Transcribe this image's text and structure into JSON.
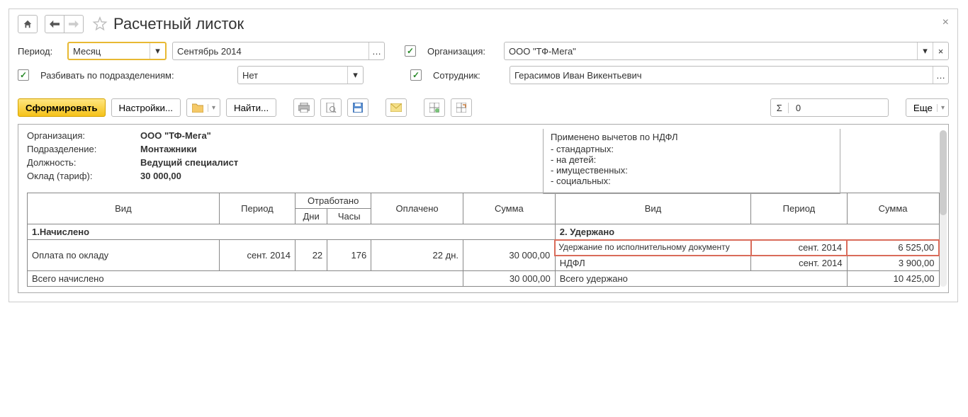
{
  "title": "Расчетный листок",
  "filters": {
    "period_label": "Период:",
    "period_mode": "Месяц",
    "period_value": "Сентябрь 2014",
    "org_label": "Организация:",
    "org_value": "ООО \"ТФ-Мега\"",
    "split_label": "Разбивать по подразделениям:",
    "split_value": "Нет",
    "emp_label": "Сотрудник:",
    "emp_value": "Герасимов Иван Викентьевич"
  },
  "toolbar": {
    "generate": "Сформировать",
    "settings": "Настройки...",
    "find": "Найти...",
    "sigma_value": "0",
    "more": "Еще"
  },
  "report": {
    "org_label": "Организация:",
    "org_value": "ООО \"ТФ-Мега\"",
    "dept_label": "Подразделение:",
    "dept_value": "Монтажники",
    "pos_label": "Должность:",
    "pos_value": "Ведущий специалист",
    "salary_label": "Оклад (тариф):",
    "salary_value": "30 000,00",
    "ded_header": "Применено вычетов по НДФЛ",
    "ded_std": "- стандартных:",
    "ded_kids": "- на детей:",
    "ded_prop": "- имущественных:",
    "ded_soc": "- социальных:"
  },
  "grid": {
    "h_type": "Вид",
    "h_period": "Период",
    "h_worked": "Отработано",
    "h_paid": "Оплачено",
    "h_sum": "Сумма",
    "h_days": "Дни",
    "h_hours": "Часы",
    "sec1": "1.Начислено",
    "sec2": "2. Удержано",
    "r1_name": "Оплата по окладу",
    "r1_period": "сент. 2014",
    "r1_days": "22",
    "r1_hours": "176",
    "r1_paid": "22 дн.",
    "r1_sum": "30 000,00",
    "r2_name": "Удержание по исполнительному документу",
    "r2_period": "сент. 2014",
    "r2_sum": "6 525,00",
    "r3_name": "НДФЛ",
    "r3_period": "сент. 2014",
    "r3_sum": "3 900,00",
    "tot1_name": "Всего начислено",
    "tot1_sum": "30 000,00",
    "tot2_name": "Всего удержано",
    "tot2_sum": "10 425,00"
  }
}
